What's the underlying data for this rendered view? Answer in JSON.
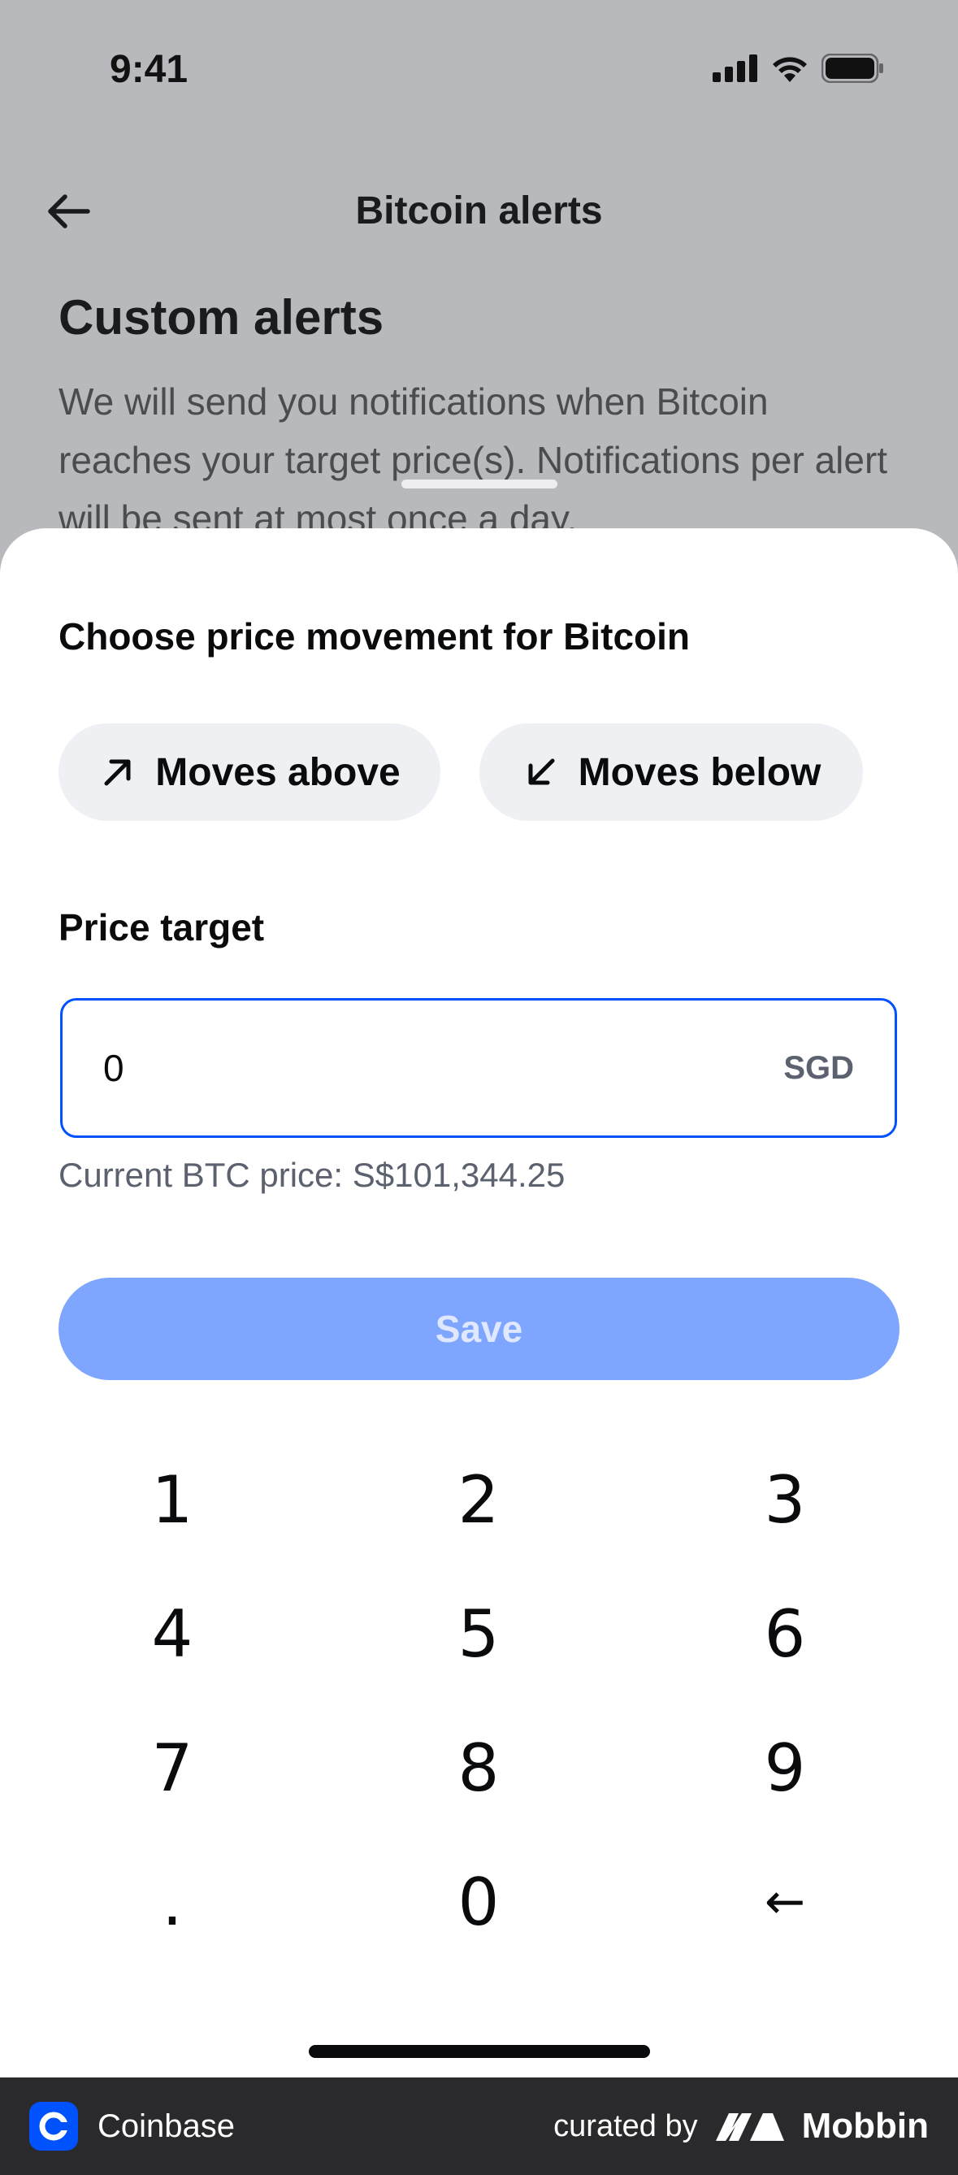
{
  "status_bar": {
    "time": "9:41"
  },
  "header": {
    "title": "Bitcoin alerts"
  },
  "background": {
    "section_title": "Custom alerts",
    "description": "We will send you notifications when Bitcoin reaches your target price(s). Notifications per alert will be sent at most once a day."
  },
  "sheet": {
    "heading": "Choose price movement for Bitcoin",
    "options": [
      {
        "label": "Moves above",
        "icon": "arrow-up-right-icon"
      },
      {
        "label": "Moves below",
        "icon": "arrow-down-left-icon"
      }
    ],
    "price_label": "Price target",
    "price_value": "0",
    "currency": "SGD",
    "current_price": "Current BTC price: S$101,344.25",
    "save_label": "Save"
  },
  "keypad": {
    "keys": [
      "1",
      "2",
      "3",
      "4",
      "5",
      "6",
      "7",
      "8",
      "9",
      ".",
      "0",
      "←"
    ]
  },
  "footer": {
    "brand": "Coinbase",
    "curated_by": "curated by",
    "curator": "Mobbin"
  },
  "colors": {
    "accent": "#0052ff",
    "save_disabled": "#7fa6ff",
    "chip_bg": "#eef0f3",
    "overlay_bg": "#b8b9bc"
  }
}
